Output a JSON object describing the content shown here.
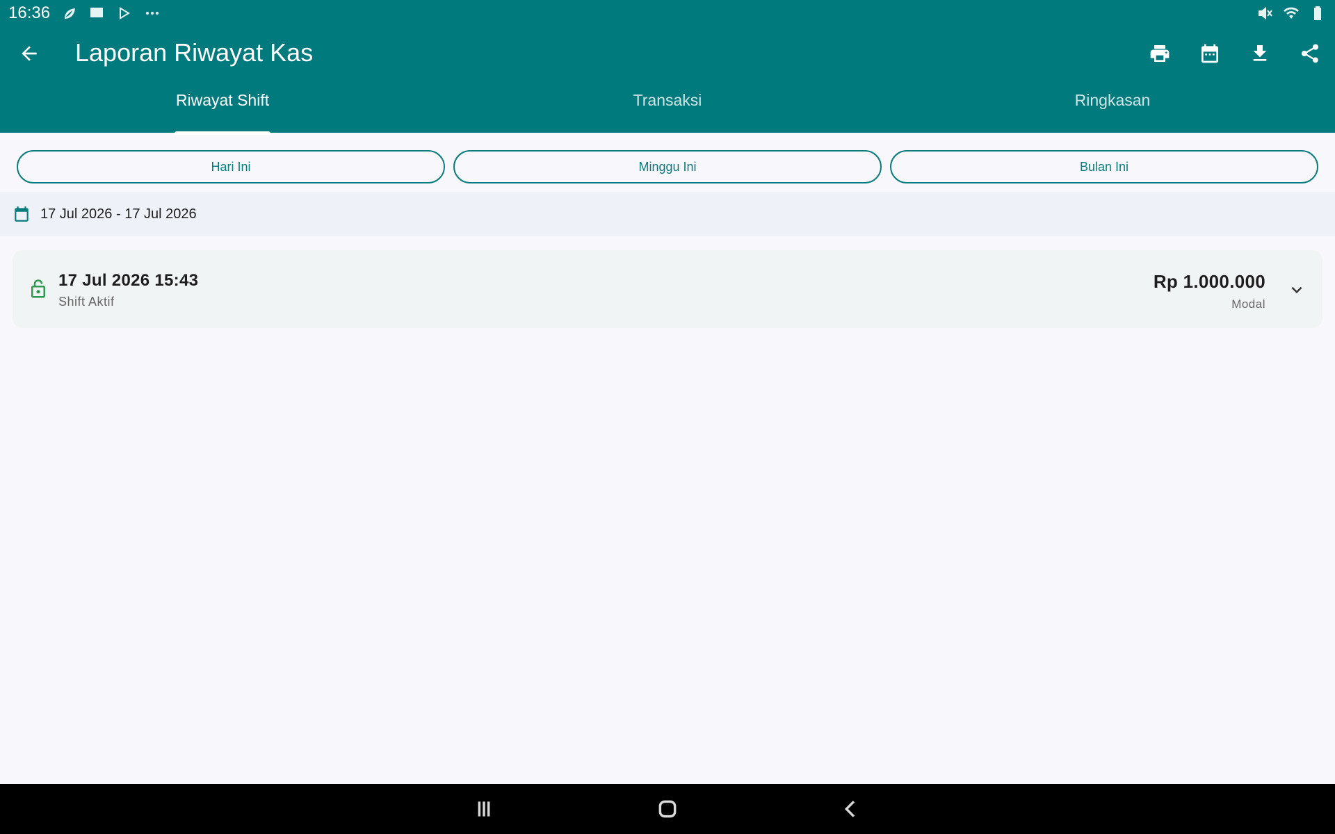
{
  "status_bar": {
    "time": "16:36",
    "left_icons": [
      "leaf-icon",
      "store-icon",
      "play-store-icon",
      "more-dots-icon"
    ],
    "right_icons": [
      "mute-icon",
      "wifi-icon",
      "battery-icon"
    ]
  },
  "app_bar": {
    "title": "Laporan Riwayat Kas",
    "actions": [
      "print-icon",
      "calendar-icon",
      "download-icon",
      "share-icon"
    ]
  },
  "tabs": [
    {
      "label": "Riwayat Shift",
      "active": true
    },
    {
      "label": "Transaksi",
      "active": false
    },
    {
      "label": "Ringkasan",
      "active": false
    }
  ],
  "filters": [
    {
      "label": "Hari Ini"
    },
    {
      "label": "Minggu Ini"
    },
    {
      "label": "Bulan Ini"
    }
  ],
  "date_range": {
    "text": "17 Jul 2026 - 17 Jul 2026"
  },
  "shifts": [
    {
      "datetime": "17 Jul 2026 15:43",
      "status": "Shift Aktif",
      "amount": "Rp 1.000.000",
      "amount_label": "Modal"
    }
  ],
  "colors": {
    "primary": "#007a7d",
    "accent": "#0b7c7e",
    "lock_green": "#2e9a4f",
    "background": "#f8f8fc"
  }
}
